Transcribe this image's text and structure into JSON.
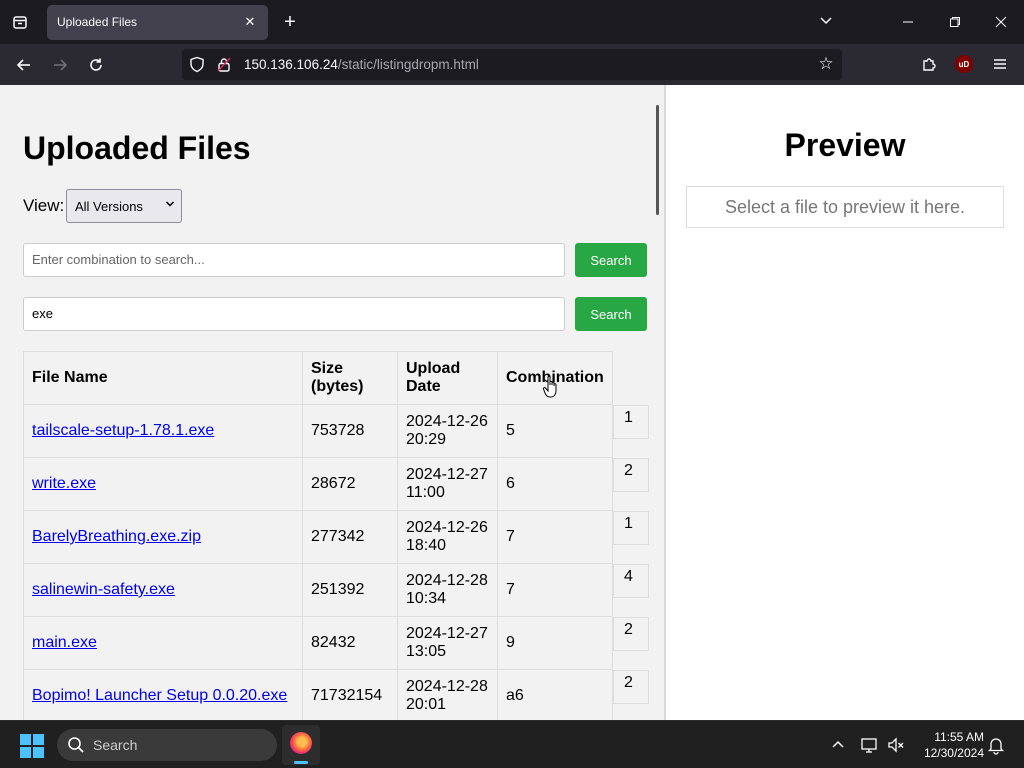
{
  "browser": {
    "tab": {
      "title": "Uploaded Files"
    },
    "url": {
      "host": "150.136.106.24",
      "path": "/static/listingdropm.html"
    },
    "extension_badge": "uD"
  },
  "page": {
    "title": "Uploaded Files",
    "view": {
      "label": "View:",
      "selected": "All Versions"
    },
    "search1": {
      "placeholder": "Enter combination to search...",
      "button": "Search"
    },
    "search2": {
      "value": "exe",
      "button": "Search"
    },
    "table": {
      "headers": [
        "File Name",
        "Size (bytes)",
        "Upload Date",
        "Combination"
      ],
      "rows": [
        {
          "name": "tailscale-setup-1.78.1.exe",
          "size": "753728",
          "date": "2024-12-26 20:29",
          "combination": "5",
          "extra": "1"
        },
        {
          "name": "write.exe",
          "size": "28672",
          "date": "2024-12-27 11:00",
          "combination": "6",
          "extra": "2"
        },
        {
          "name": "BarelyBreathing.exe.zip",
          "size": "277342",
          "date": "2024-12-26 18:40",
          "combination": "7",
          "extra": "1"
        },
        {
          "name": "salinewin-safety.exe",
          "size": "251392",
          "date": "2024-12-28 10:34",
          "combination": "7",
          "extra": "4"
        },
        {
          "name": "main.exe",
          "size": "82432",
          "date": "2024-12-27 13:05",
          "combination": "9",
          "extra": "2"
        },
        {
          "name": "Bopimo! Launcher Setup 0.0.20.exe",
          "size": "71732154",
          "date": "2024-12-28 20:01",
          "combination": "a6",
          "extra": "2"
        }
      ]
    },
    "preview": {
      "title": "Preview",
      "placeholder": "Select a file to preview it here."
    }
  },
  "taskbar": {
    "search_label": "Search",
    "time": "11:55 AM",
    "date": "12/30/2024"
  },
  "colors": {
    "accent_button": "#28a745",
    "link": "#0000ee",
    "taskbar": "#202020"
  }
}
